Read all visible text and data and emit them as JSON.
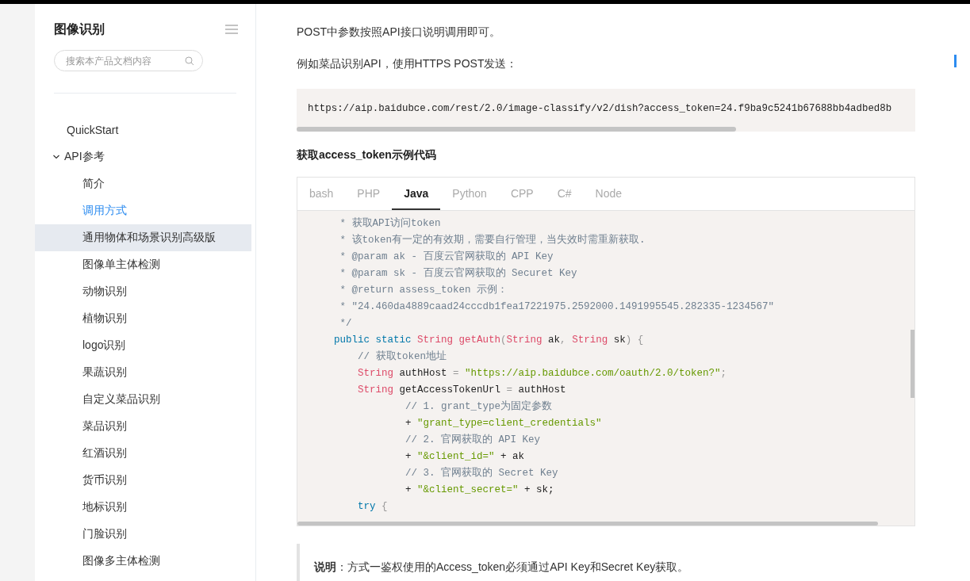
{
  "sidebar": {
    "title": "图像识别",
    "search": {
      "placeholder": "搜索本产品文档内容"
    },
    "items": [
      {
        "label": "QuickStart",
        "selected": false,
        "hovered": false
      },
      {
        "label": "API参考",
        "selected": false,
        "hovered": false,
        "expanded": true,
        "children": [
          {
            "label": "简介",
            "selected": false,
            "hovered": false
          },
          {
            "label": "调用方式",
            "selected": true,
            "hovered": false
          },
          {
            "label": "通用物体和场景识别高级版",
            "selected": false,
            "hovered": true
          },
          {
            "label": "图像单主体检测",
            "selected": false,
            "hovered": false
          },
          {
            "label": "动物识别",
            "selected": false,
            "hovered": false
          },
          {
            "label": "植物识别",
            "selected": false,
            "hovered": false
          },
          {
            "label": "logo识别",
            "selected": false,
            "hovered": false
          },
          {
            "label": "果蔬识别",
            "selected": false,
            "hovered": false
          },
          {
            "label": "自定义菜品识别",
            "selected": false,
            "hovered": false
          },
          {
            "label": "菜品识别",
            "selected": false,
            "hovered": false
          },
          {
            "label": "红酒识别",
            "selected": false,
            "hovered": false
          },
          {
            "label": "货币识别",
            "selected": false,
            "hovered": false
          },
          {
            "label": "地标识别",
            "selected": false,
            "hovered": false
          },
          {
            "label": "门脸识别",
            "selected": false,
            "hovered": false
          },
          {
            "label": "图像多主体检测",
            "selected": false,
            "hovered": false
          }
        ]
      }
    ]
  },
  "content": {
    "paragraphs": [
      "POST中参数按照API接口说明调用即可。",
      "例如菜品识别API，使用HTTPS POST发送："
    ],
    "url_block": "https://aip.baidubce.com/rest/2.0/image-classify/v2/dish?access_token=24.f9ba9c5241b67688bb4adbed8b",
    "heading": "获取access_token示例代码",
    "code_tabs": [
      {
        "label": "bash",
        "selected": false
      },
      {
        "label": "PHP",
        "selected": false
      },
      {
        "label": "Java",
        "selected": true
      },
      {
        "label": "Python",
        "selected": false
      },
      {
        "label": "CPP",
        "selected": false
      },
      {
        "label": "C#",
        "selected": false
      },
      {
        "label": "Node",
        "selected": false
      }
    ],
    "code_lines": [
      [
        {
          "kind": "comment",
          "text": " * 获取API访问token"
        }
      ],
      [
        {
          "kind": "comment",
          "text": " * 该token有一定的有效期，需要自行管理，当失效时需重新获取."
        }
      ],
      [
        {
          "kind": "comment",
          "text": " * @param ak - 百度云官网获取的 API Key"
        }
      ],
      [
        {
          "kind": "comment",
          "text": " * @param sk - 百度云官网获取的 Securet Key"
        }
      ],
      [
        {
          "kind": "comment",
          "text": " * @return assess_token 示例："
        }
      ],
      [
        {
          "kind": "comment",
          "text": " * \"24.460da4889caad24cccdb1fea17221975.2592000.1491995545.282335-1234567\""
        }
      ],
      [
        {
          "kind": "comment",
          "text": " */"
        }
      ],
      [
        {
          "kind": "keyword",
          "text": "public static "
        },
        {
          "kind": "type",
          "text": "String "
        },
        {
          "kind": "func",
          "text": "getAuth"
        },
        {
          "kind": "punct",
          "text": "("
        },
        {
          "kind": "type",
          "text": "String "
        },
        {
          "kind": "plain",
          "text": "ak"
        },
        {
          "kind": "punct",
          "text": ", "
        },
        {
          "kind": "type",
          "text": "String "
        },
        {
          "kind": "plain",
          "text": "sk"
        },
        {
          "kind": "punct",
          "text": ") {"
        }
      ],
      [
        {
          "kind": "comment",
          "text": "    // 获取token地址"
        }
      ],
      [
        {
          "kind": "type",
          "text": "    String "
        },
        {
          "kind": "plain",
          "text": "authHost "
        },
        {
          "kind": "punct",
          "text": "= "
        },
        {
          "kind": "string",
          "text": "\"https://aip.baidubce.com/oauth/2.0/token?\""
        },
        {
          "kind": "punct",
          "text": ";"
        }
      ],
      [
        {
          "kind": "type",
          "text": "    String "
        },
        {
          "kind": "plain",
          "text": "getAccessTokenUrl "
        },
        {
          "kind": "punct",
          "text": "= "
        },
        {
          "kind": "plain",
          "text": "authHost"
        }
      ],
      [
        {
          "kind": "comment",
          "text": "            // 1. grant_type为固定参数"
        }
      ],
      [
        {
          "kind": "plain",
          "text": "            + "
        },
        {
          "kind": "string",
          "text": "\"grant_type=client_credentials\""
        }
      ],
      [
        {
          "kind": "comment",
          "text": "            // 2. 官网获取的 API Key"
        }
      ],
      [
        {
          "kind": "plain",
          "text": "            + "
        },
        {
          "kind": "string",
          "text": "\"&client_id=\""
        },
        {
          "kind": "plain",
          "text": " + ak"
        }
      ],
      [
        {
          "kind": "comment",
          "text": "            // 3. 官网获取的 Secret Key"
        }
      ],
      [
        {
          "kind": "plain",
          "text": "            + "
        },
        {
          "kind": "string",
          "text": "\"&client_secret=\""
        },
        {
          "kind": "plain",
          "text": " + sk;"
        }
      ],
      [
        {
          "kind": "keyword",
          "text": "    try "
        },
        {
          "kind": "punct",
          "text": "{"
        }
      ]
    ],
    "note": "**说明**：方式一鉴权使用的Access_token必须通过API Key和Secret Key获取。"
  }
}
